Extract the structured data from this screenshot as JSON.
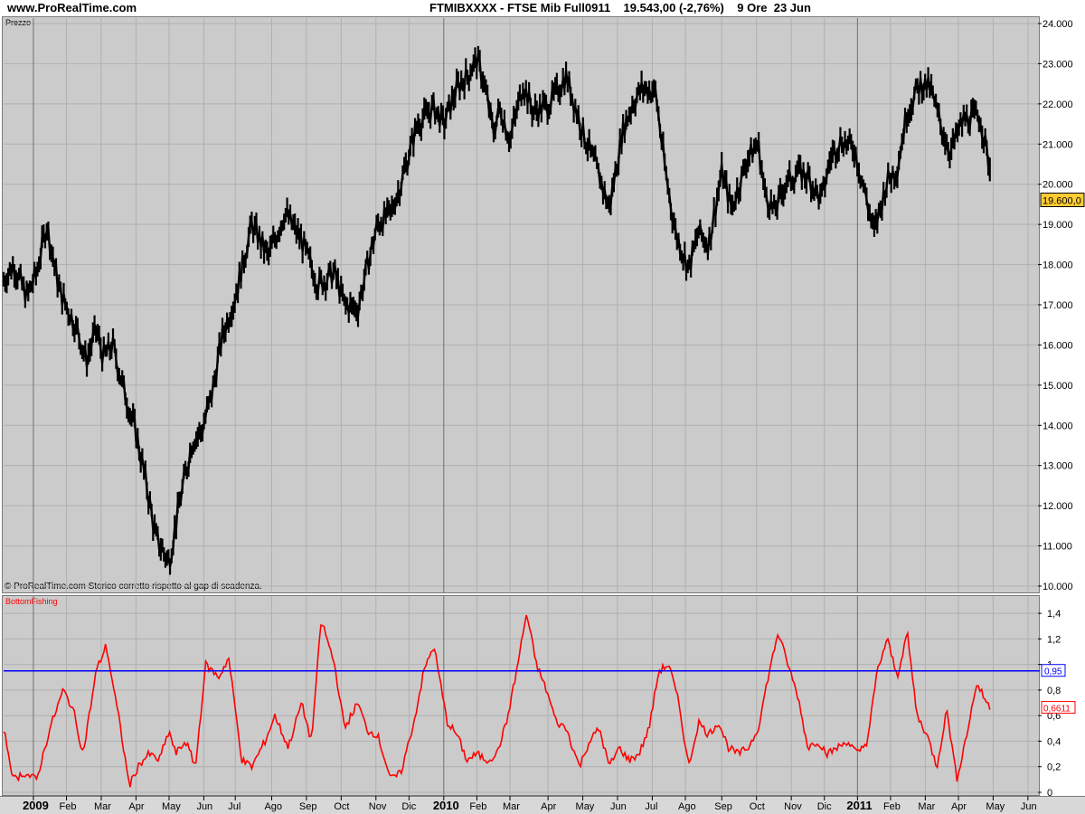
{
  "header": {
    "site": "www.ProRealTime.com",
    "title": "FTMIBXXXX - FTSE Mib Full0911    19.543,00 (-2,76%)    9 Ore  23 Jun"
  },
  "chart_data": [
    {
      "type": "line",
      "panel_label": "Prezzo",
      "footer_note": "© ProRealTime.com  Storico corretto rispetto al gap di scadenza.",
      "ylim": [
        10000,
        24000
      ],
      "yticks": [
        10000,
        11000,
        12000,
        13000,
        14000,
        15000,
        16000,
        17000,
        18000,
        19000,
        20000,
        21000,
        22000,
        23000,
        24000
      ],
      "ytick_labels": [
        "10.000",
        "11.000",
        "12.000",
        "13.000",
        "14.000",
        "15.000",
        "16.000",
        "17.000",
        "18.000",
        "19.000",
        "20.000",
        "21.000",
        "22.000",
        "23.000",
        "24.000"
      ],
      "last_value_label": "19.600,0",
      "series_color": "#000000",
      "series": [
        {
          "t": [
            0,
            0.3,
            0.7,
            1.0,
            1.3,
            1.7,
            2.0,
            2.3,
            2.5,
            2.8,
            3.0,
            3.3,
            3.6,
            4.0,
            4.3,
            4.6,
            5.0,
            5.3,
            5.7,
            6.0,
            6.3,
            6.6,
            7.0,
            7.5,
            8.0,
            8.5,
            9.0,
            9.5,
            10.0,
            10.3,
            10.7,
            11.0,
            11.3,
            11.7,
            12.0,
            12.5,
            13.0,
            13.3,
            13.7,
            14.0,
            14.3,
            14.5,
            14.8,
            15.0,
            15.3,
            15.7,
            16.0,
            16.5,
            17.0,
            17.5,
            18.0,
            18.3,
            18.7,
            19.0,
            19.3,
            19.7,
            20.0,
            20.3,
            20.7,
            21.0,
            21.3,
            21.7,
            22.0,
            22.5,
            22.8,
            23.0,
            23.3,
            23.6,
            24.0,
            24.3,
            24.7,
            25.0,
            25.3,
            25.7,
            26.0,
            26.3,
            26.7,
            27.0,
            27.3,
            27.7,
            28.0,
            28.3,
            28.6,
            29.0,
            29.5,
            29.8
          ],
          "y": [
            17600,
            18000,
            17200,
            17800,
            19000,
            17300,
            16800,
            16200,
            15600,
            16400,
            15700,
            16000,
            15000,
            13800,
            12600,
            11200,
            10600,
            12000,
            13600,
            13900,
            14800,
            16200,
            17200,
            19000,
            18200,
            19300,
            18600,
            17500,
            17800,
            17000,
            16900,
            18000,
            19000,
            19300,
            20000,
            21500,
            21900,
            21500,
            22400,
            22700,
            23100,
            22600,
            21300,
            21900,
            21100,
            22500,
            21800,
            22000,
            22700,
            21300,
            20200,
            19400,
            21300,
            22000,
            22400,
            22300,
            20300,
            18800,
            17900,
            18800,
            18500,
            20300,
            19400,
            20700,
            21000,
            19800,
            19300,
            20000,
            20300,
            20200,
            19600,
            20700,
            21100,
            20900,
            19900,
            18800,
            20100,
            20400,
            21800,
            22500,
            22400,
            21500,
            20800,
            21600,
            21700,
            20400,
            19543
          ]
        }
      ]
    },
    {
      "type": "line",
      "panel_label": "BottomFishing",
      "ylim": [
        0,
        1.5
      ],
      "yticks": [
        0,
        0.2,
        0.4,
        0.6,
        0.8,
        1.0,
        1.2,
        1.4
      ],
      "ytick_labels": [
        "0",
        "0,2",
        "0,4",
        "0,6",
        "0,8",
        "1",
        "1,2",
        "1,4"
      ],
      "threshold": 0.95,
      "threshold_label": "0,95",
      "threshold_color": "#0000ff",
      "last_value_label": "0,6611",
      "series_color": "#ff0000",
      "series": [
        {
          "t": [
            0,
            0.3,
            0.6,
            1.0,
            1.4,
            1.8,
            2.1,
            2.4,
            2.8,
            3.1,
            3.5,
            3.8,
            4.1,
            4.4,
            4.7,
            5.0,
            5.2,
            5.5,
            5.8,
            6.1,
            6.5,
            6.8,
            7.2,
            7.5,
            7.9,
            8.2,
            8.6,
            9.0,
            9.3,
            9.6,
            10.0,
            10.3,
            10.7,
            11.0,
            11.3,
            11.7,
            12.0,
            12.4,
            12.7,
            13.0,
            13.4,
            13.7,
            14.0,
            14.3,
            14.6,
            14.9,
            15.2,
            15.5,
            15.8,
            16.1,
            16.4,
            16.7,
            17.0,
            17.4,
            17.7,
            18.0,
            18.3,
            18.6,
            18.9,
            19.2,
            19.5,
            19.8,
            20.1,
            20.4,
            20.7,
            21.0,
            21.3,
            21.6,
            21.9,
            22.2,
            22.5,
            22.8,
            23.1,
            23.4,
            23.7,
            24.0,
            24.3,
            24.6,
            24.9,
            25.2,
            25.5,
            25.8,
            26.1,
            26.4,
            26.7,
            27.0,
            27.3,
            27.6,
            27.9,
            28.2,
            28.5,
            28.8,
            29.1,
            29.4,
            29.8
          ],
          "y": [
            0.5,
            0.1,
            0.15,
            0.1,
            0.5,
            0.8,
            0.65,
            0.3,
            0.95,
            1.15,
            0.55,
            0.05,
            0.22,
            0.3,
            0.25,
            0.48,
            0.3,
            0.4,
            0.2,
            1.0,
            0.9,
            1.05,
            0.25,
            0.2,
            0.4,
            0.6,
            0.35,
            0.7,
            0.4,
            1.35,
            1.0,
            0.5,
            0.7,
            0.48,
            0.45,
            0.1,
            0.15,
            0.55,
            0.95,
            1.15,
            0.55,
            0.45,
            0.25,
            0.3,
            0.25,
            0.3,
            0.55,
            0.95,
            1.4,
            1.0,
            0.8,
            0.55,
            0.5,
            0.2,
            0.4,
            0.5,
            0.2,
            0.35,
            0.25,
            0.3,
            0.5,
            0.95,
            1.0,
            0.7,
            0.2,
            0.55,
            0.45,
            0.55,
            0.35,
            0.3,
            0.35,
            0.5,
            0.9,
            1.25,
            1.0,
            0.75,
            0.35,
            0.4,
            0.3,
            0.35,
            0.4,
            0.3,
            0.4,
            0.95,
            1.2,
            0.9,
            1.25,
            0.6,
            0.45,
            0.2,
            0.65,
            0.1,
            0.45,
            0.85,
            0.66
          ]
        }
      ]
    }
  ],
  "x_axis": {
    "ticks": [
      {
        "label": "2009",
        "t": 0.9,
        "year": true
      },
      {
        "label": "Feb",
        "t": 1.9,
        "year": false
      },
      {
        "label": "Mar",
        "t": 2.95,
        "year": false
      },
      {
        "label": "Apr",
        "t": 4.0,
        "year": false
      },
      {
        "label": "May",
        "t": 5.0,
        "year": false
      },
      {
        "label": "Jun",
        "t": 6.05,
        "year": false
      },
      {
        "label": "Jul",
        "t": 7.0,
        "year": false
      },
      {
        "label": "Ago",
        "t": 8.1,
        "year": false
      },
      {
        "label": "Sep",
        "t": 9.15,
        "year": false
      },
      {
        "label": "Oct",
        "t": 10.2,
        "year": false
      },
      {
        "label": "Nov",
        "t": 11.25,
        "year": false
      },
      {
        "label": "Dic",
        "t": 12.25,
        "year": false
      },
      {
        "label": "2010",
        "t": 13.3,
        "year": true
      },
      {
        "label": "Feb",
        "t": 14.3,
        "year": false
      },
      {
        "label": "Mar",
        "t": 15.3,
        "year": false
      },
      {
        "label": "Apr",
        "t": 16.45,
        "year": false
      },
      {
        "label": "May",
        "t": 17.5,
        "year": false
      },
      {
        "label": "Jun",
        "t": 18.55,
        "year": false
      },
      {
        "label": "Jul",
        "t": 19.6,
        "year": false
      },
      {
        "label": "Ago",
        "t": 20.6,
        "year": false
      },
      {
        "label": "Sep",
        "t": 21.7,
        "year": false
      },
      {
        "label": "Oct",
        "t": 22.75,
        "year": false
      },
      {
        "label": "Nov",
        "t": 23.8,
        "year": false
      },
      {
        "label": "Dic",
        "t": 24.8,
        "year": false
      },
      {
        "label": "2011",
        "t": 25.8,
        "year": true
      },
      {
        "label": "Feb",
        "t": 26.8,
        "year": false
      },
      {
        "label": "Mar",
        "t": 27.85,
        "year": false
      },
      {
        "label": "Apr",
        "t": 28.85,
        "year": false
      },
      {
        "label": "May",
        "t": 29.9,
        "year": false
      },
      {
        "label": "Jun",
        "t": 30.95,
        "year": false
      }
    ]
  }
}
